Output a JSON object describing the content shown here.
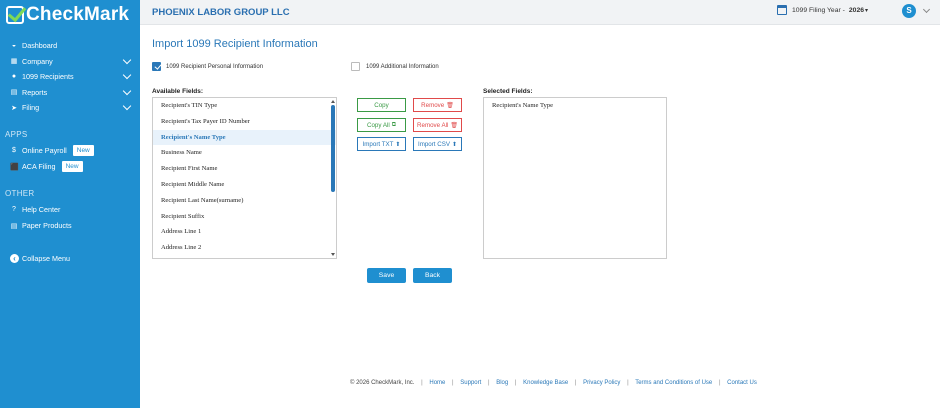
{
  "app": {
    "logo": "CheckMark"
  },
  "sidebar": {
    "items": [
      {
        "label": "Dashboard",
        "icon": "dashboard-icon",
        "glyph": "◒"
      },
      {
        "label": "Company",
        "icon": "building-icon",
        "glyph": "▦"
      },
      {
        "label": "1099 Recipients",
        "icon": "user-icon",
        "glyph": "●"
      },
      {
        "label": "Reports",
        "icon": "document-icon",
        "glyph": "▤"
      },
      {
        "label": "Filing",
        "icon": "send-icon",
        "glyph": "➤"
      }
    ],
    "apps_heading": "APPS",
    "apps": [
      {
        "label": "Online Payroll",
        "icon": "dollar-icon",
        "glyph": "$",
        "badge": "New"
      },
      {
        "label": "ACA Filing",
        "icon": "shield-icon",
        "glyph": "⬛",
        "badge": "New"
      }
    ],
    "other_heading": "OTHER",
    "other": [
      {
        "label": "Help Center",
        "icon": "help-icon",
        "glyph": "?"
      },
      {
        "label": "Paper Products",
        "icon": "paper-icon",
        "glyph": "▤"
      }
    ],
    "collapse_label": "Collapse Menu"
  },
  "header": {
    "company": "PHOENIX LABOR GROUP LLC",
    "filing_year_label": "1099 Filing Year -",
    "filing_year": "2026",
    "avatar": "S"
  },
  "main": {
    "title": "Import 1099 Recipient Information",
    "option_personal": "1099 Recipient Personal Information",
    "option_additional": "1099 Additional Information",
    "available_label": "Available Fields:",
    "selected_label": "Selected Fields:",
    "available_fields": [
      "Recipient's TIN Type",
      "Recipient's Tax Payer ID Number",
      "Recipient's Name Type",
      "Business Name",
      "Recipient First Name",
      "Recipient Middle Name",
      "Recipient Last Name(surname)",
      "Recipient Suffix",
      "Address Line 1",
      "Address Line 2"
    ],
    "selected_fields": [
      "Recipient's Name Type"
    ],
    "buttons": {
      "copy": "Copy",
      "remove": "Remove",
      "copy_all": "Copy All",
      "remove_all": "Remove All",
      "import_txt": "Import TXT",
      "import_csv": "Import CSV",
      "save": "Save",
      "back": "Back"
    }
  },
  "footer": {
    "copyright": "© 2026 CheckMark, Inc.",
    "links": [
      "Home",
      "Support",
      "Blog",
      "Knowledge Base",
      "Privacy Policy",
      "Terms and Conditions of Use",
      "Contact Us"
    ]
  },
  "colors": {
    "sidebar": "#1f8fd0",
    "accent": "#2a78b8",
    "green": "#3a9a45",
    "red": "#e04a4a"
  }
}
